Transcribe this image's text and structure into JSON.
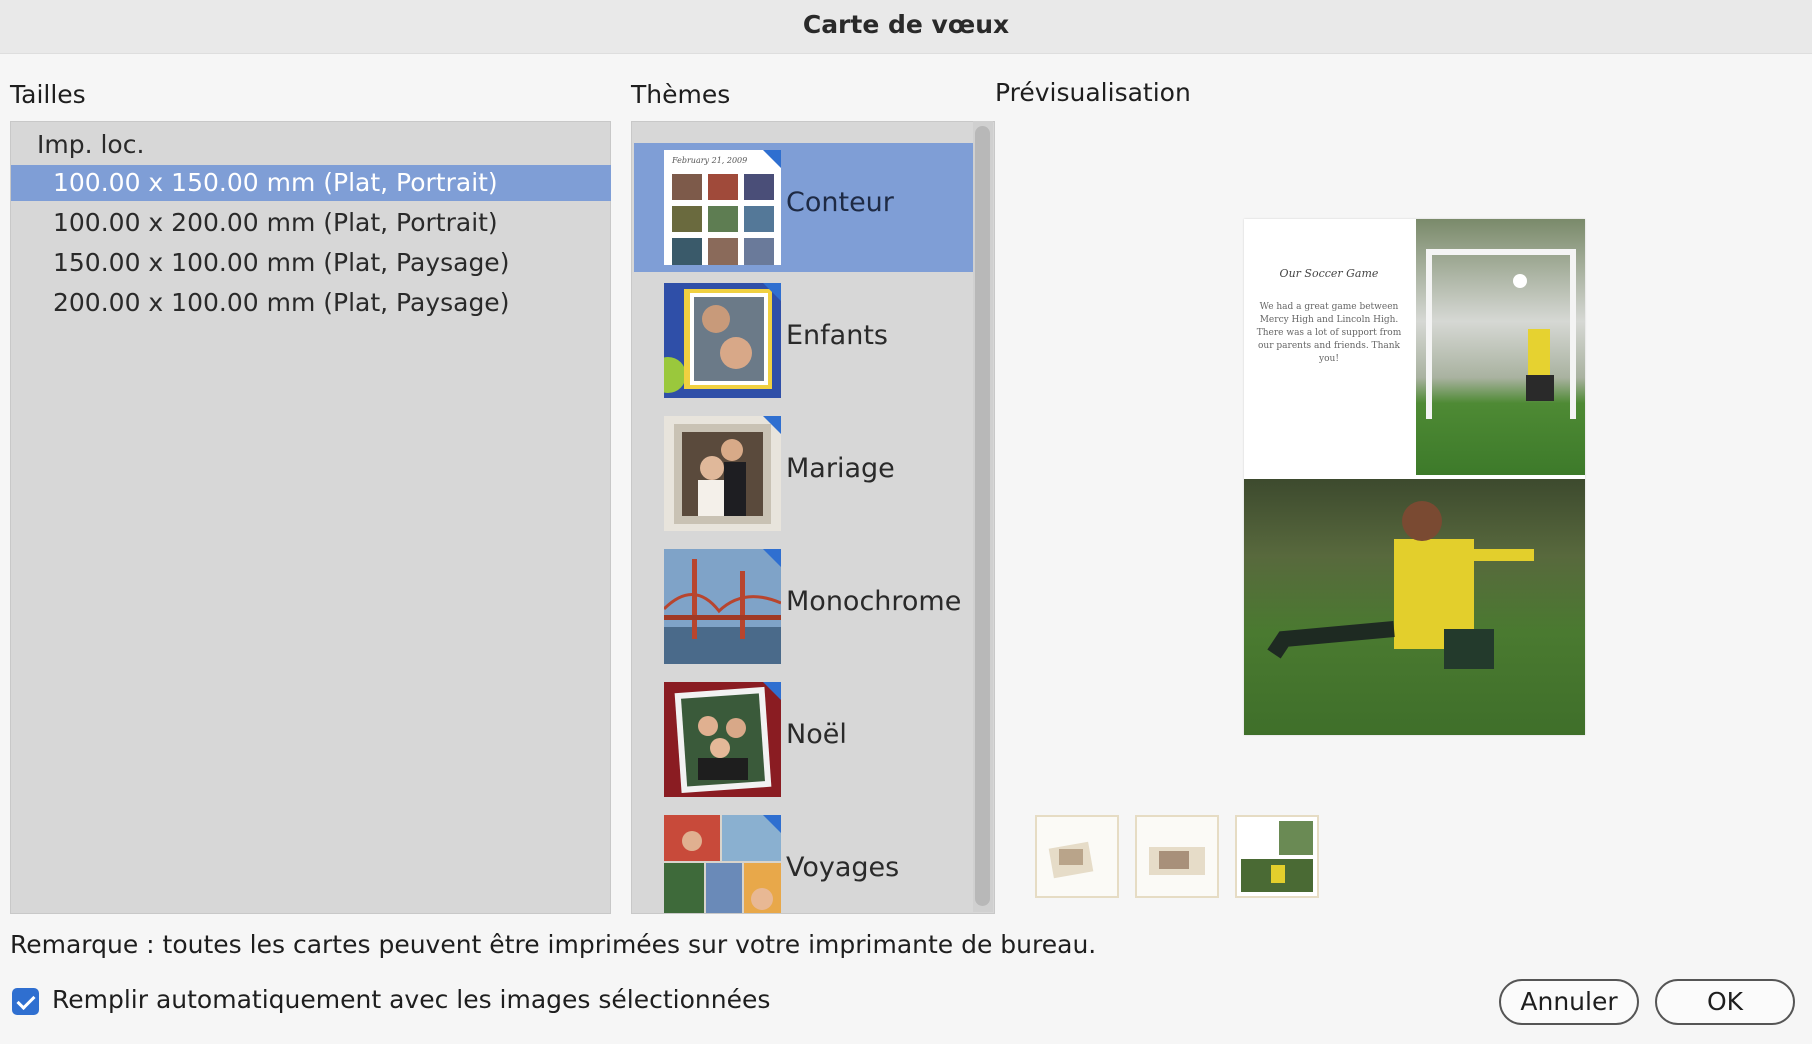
{
  "dialog": {
    "title": "Carte de vœux"
  },
  "sections": {
    "sizes_label": "Tailles",
    "themes_label": "Thèmes",
    "preview_label": "Prévisualisation"
  },
  "sizes": {
    "group": "Imp. loc.",
    "items": [
      {
        "label": "100.00 x 150.00 mm (Plat, Portrait)",
        "selected": true
      },
      {
        "label": "100.00 x 200.00 mm (Plat, Portrait)",
        "selected": false
      },
      {
        "label": "150.00 x 100.00 mm (Plat, Paysage)",
        "selected": false
      },
      {
        "label": "200.00 x 100.00 mm (Plat, Paysage)",
        "selected": false
      }
    ]
  },
  "themes": {
    "items": [
      {
        "name": "Conteur",
        "selected": true
      },
      {
        "name": "Enfants",
        "selected": false
      },
      {
        "name": "Mariage",
        "selected": false
      },
      {
        "name": "Monochrome",
        "selected": false
      },
      {
        "name": "Noël",
        "selected": false
      },
      {
        "name": "Voyages",
        "selected": false
      }
    ]
  },
  "preview": {
    "card_title": "Our Soccer Game",
    "card_body": "We had a great game between Mercy High and Lincoln High. There was a lot of support from our parents and friends. Thank you!"
  },
  "note": "Remarque : toutes les cartes peuvent être imprimées sur votre imprimante de bureau.",
  "autofill": {
    "label": "Remplir automatiquement avec les images sélectionnées",
    "checked": true
  },
  "buttons": {
    "cancel": "Annuler",
    "ok": "OK"
  },
  "colors": {
    "selection": "#7f9ed6",
    "accent": "#2f6fd0",
    "panel": "#d7d7d7"
  }
}
